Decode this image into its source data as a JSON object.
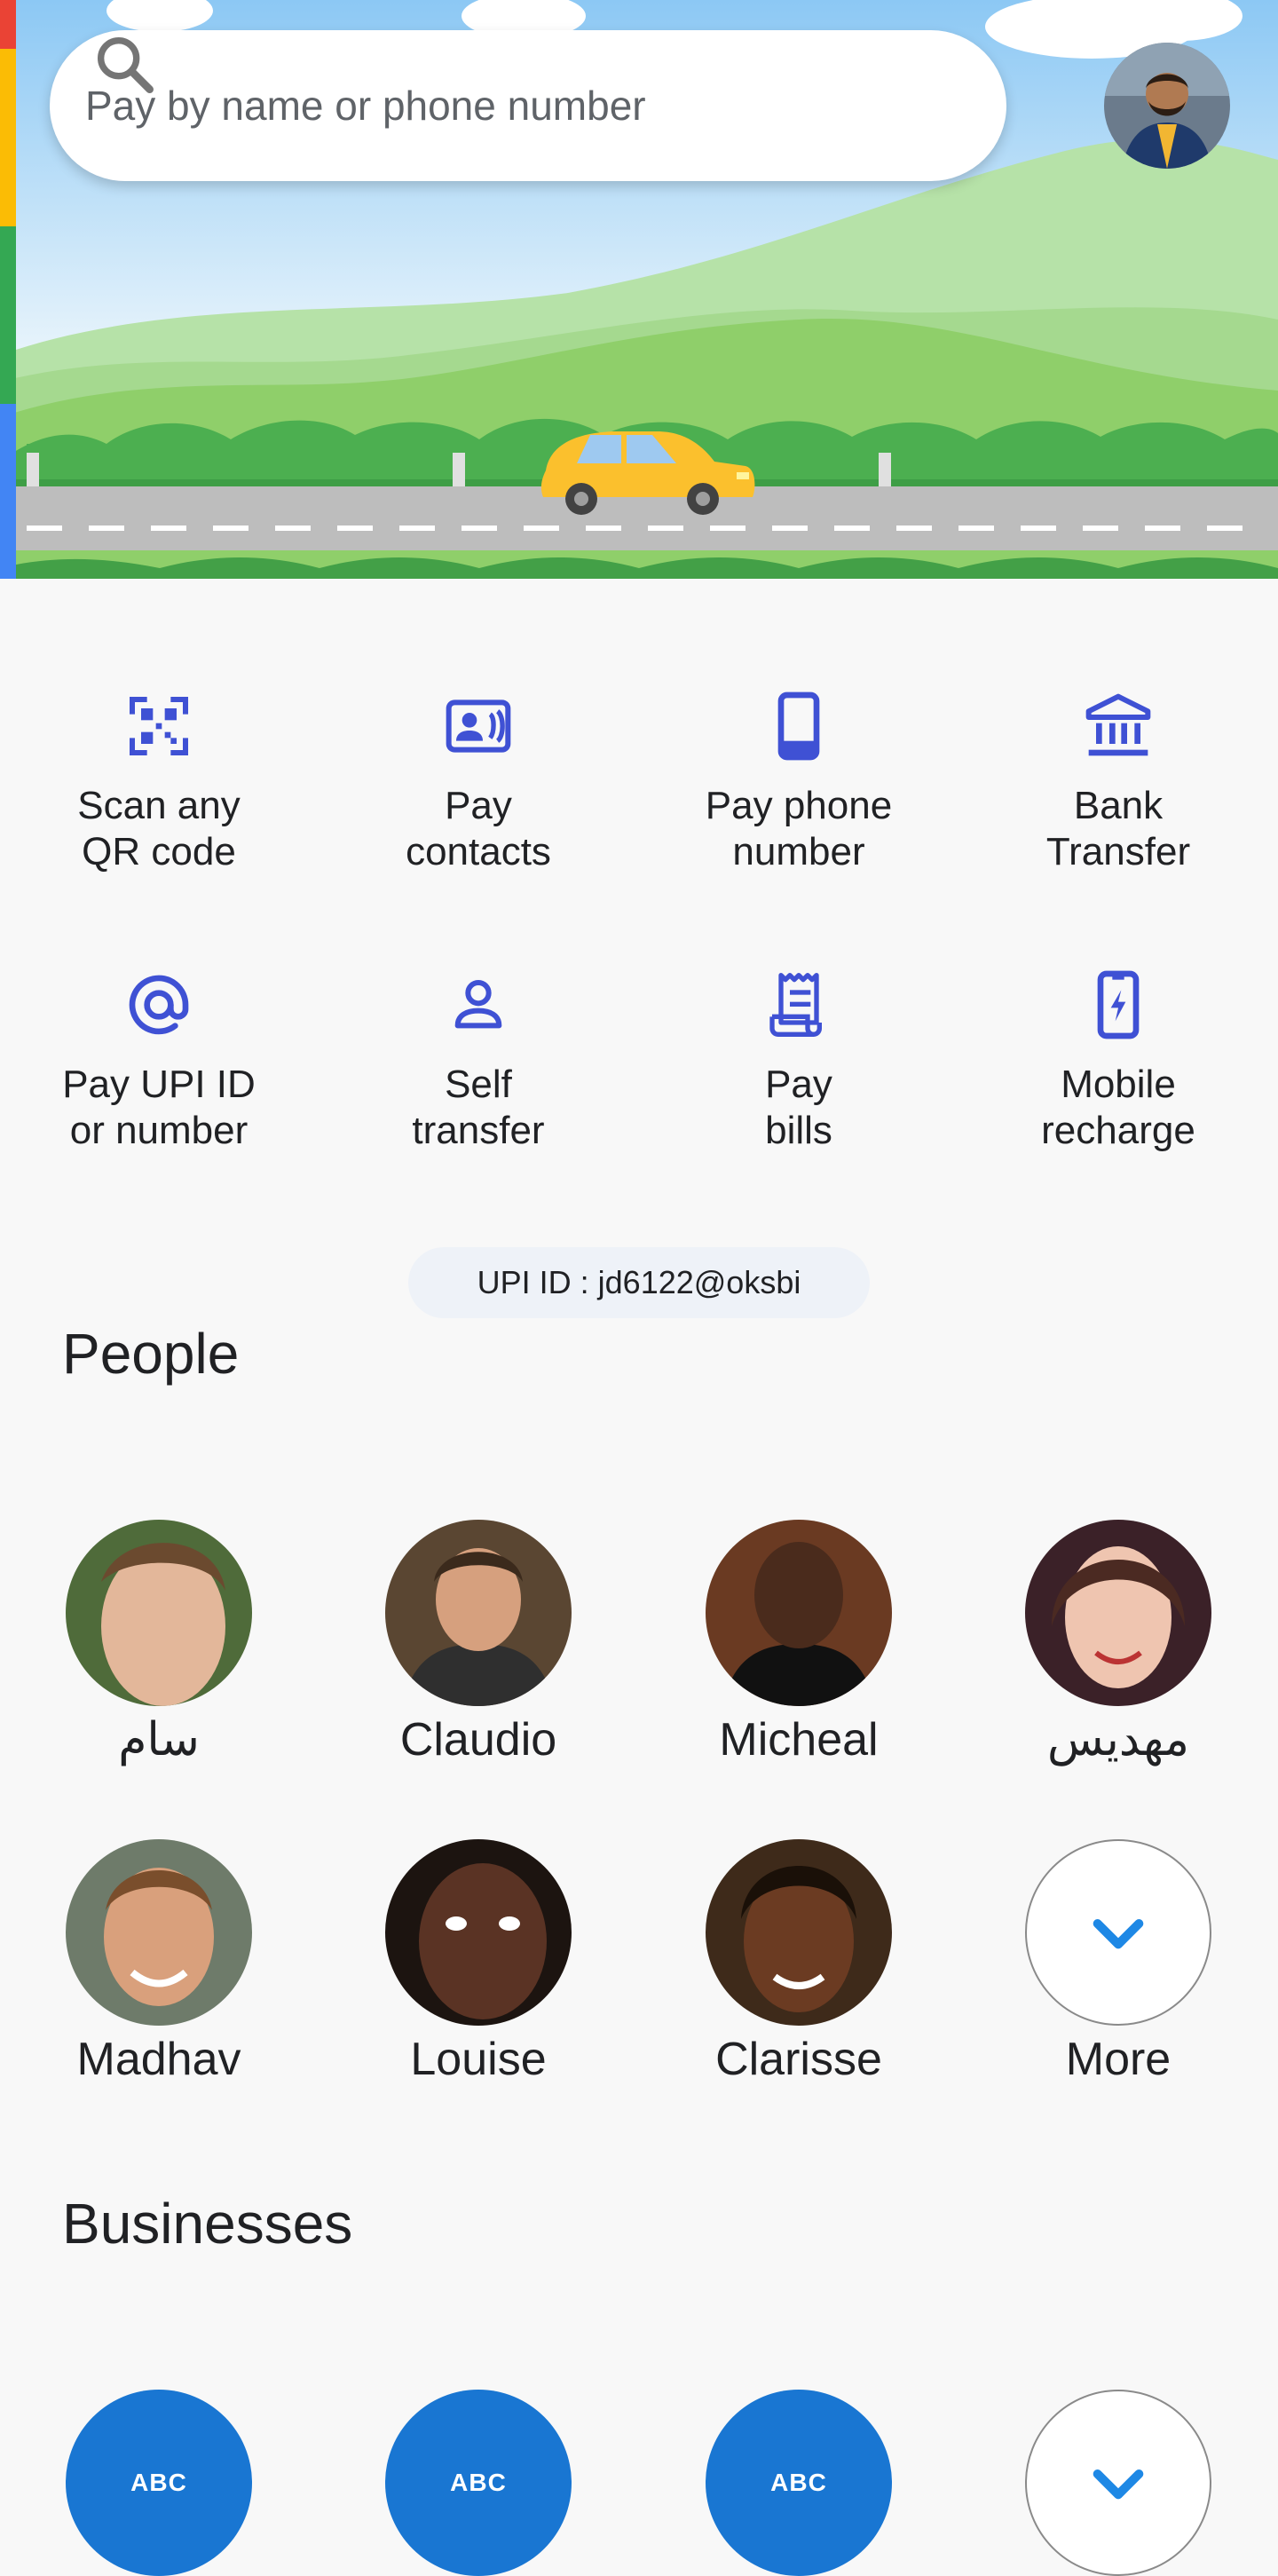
{
  "search": {
    "placeholder": "Pay by name or phone number"
  },
  "colors": {
    "accent": "#3f51d4",
    "biz": "#1976d2",
    "chevron": "#1e88e5"
  },
  "actions": [
    {
      "label": "Scan any\nQR code",
      "icon": "qr-code-icon"
    },
    {
      "label": "Pay\ncontacts",
      "icon": "contact-card-icon"
    },
    {
      "label": "Pay phone\nnumber",
      "icon": "phone-icon"
    },
    {
      "label": "Bank\nTransfer",
      "icon": "bank-icon"
    },
    {
      "label": "Pay UPI ID\nor number",
      "icon": "at-icon"
    },
    {
      "label": "Self\ntransfer",
      "icon": "person-icon"
    },
    {
      "label": "Pay\nbills",
      "icon": "receipt-icon"
    },
    {
      "label": "Mobile\nrecharge",
      "icon": "mobile-recharge-icon"
    }
  ],
  "upi_id": "UPI ID : jd6122@oksbi",
  "people": {
    "title": "People",
    "items": [
      {
        "name": "سام"
      },
      {
        "name": "Claudio"
      },
      {
        "name": "Micheal"
      },
      {
        "name": "مهدیس"
      },
      {
        "name": "Madhav"
      },
      {
        "name": "Louise"
      },
      {
        "name": "Clarisse"
      }
    ],
    "more_label": "More"
  },
  "businesses": {
    "title": "Businesses",
    "items": [
      {
        "badge": "ABC"
      },
      {
        "badge": "ABC"
      },
      {
        "badge": "ABC"
      }
    ]
  }
}
